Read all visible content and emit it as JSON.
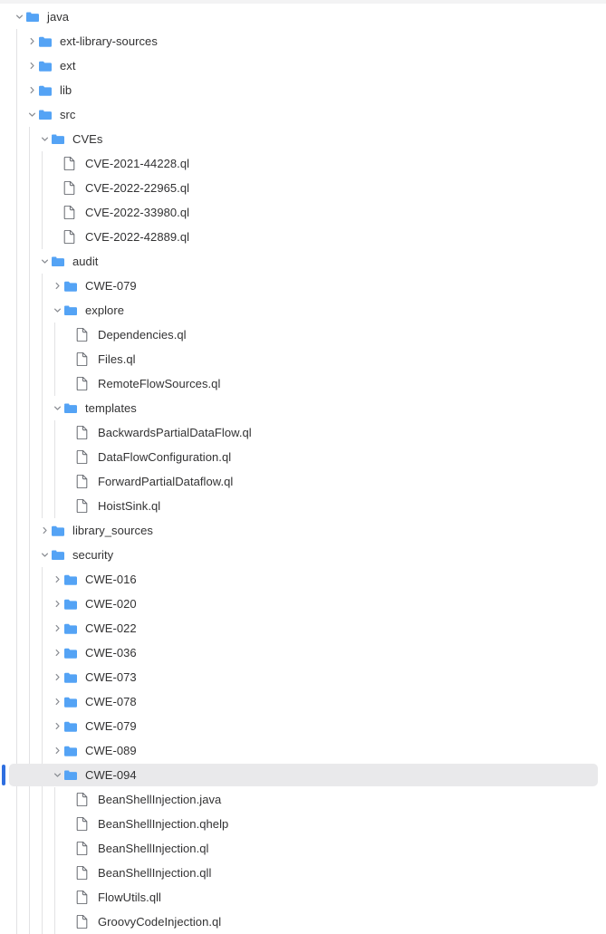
{
  "theme": {
    "background": "#ffffff",
    "text_color": "#323233",
    "folder_color": "#54a3f5",
    "file_icon_color": "#6b6e74",
    "chevron_color": "#8a8d93",
    "selection_background": "#e9e9eb",
    "selection_bar": "#2f6fe0",
    "guide_line": "#e2e2e4"
  },
  "tree": {
    "rows": [
      {
        "label": "java",
        "depth": 0,
        "type": "folder",
        "state": "expanded",
        "selected": false
      },
      {
        "label": "ext-library-sources",
        "depth": 1,
        "type": "folder",
        "state": "collapsed",
        "selected": false
      },
      {
        "label": "ext",
        "depth": 1,
        "type": "folder",
        "state": "collapsed",
        "selected": false
      },
      {
        "label": "lib",
        "depth": 1,
        "type": "folder",
        "state": "collapsed",
        "selected": false
      },
      {
        "label": "src",
        "depth": 1,
        "type": "folder",
        "state": "expanded",
        "selected": false
      },
      {
        "label": "CVEs",
        "depth": 2,
        "type": "folder",
        "state": "expanded",
        "selected": false
      },
      {
        "label": "CVE-2021-44228.ql",
        "depth": 3,
        "type": "file",
        "state": "none",
        "selected": false
      },
      {
        "label": "CVE-2022-22965.ql",
        "depth": 3,
        "type": "file",
        "state": "none",
        "selected": false
      },
      {
        "label": "CVE-2022-33980.ql",
        "depth": 3,
        "type": "file",
        "state": "none",
        "selected": false
      },
      {
        "label": "CVE-2022-42889.ql",
        "depth": 3,
        "type": "file",
        "state": "none",
        "selected": false
      },
      {
        "label": "audit",
        "depth": 2,
        "type": "folder",
        "state": "expanded",
        "selected": false
      },
      {
        "label": "CWE-079",
        "depth": 3,
        "type": "folder",
        "state": "collapsed",
        "selected": false
      },
      {
        "label": "explore",
        "depth": 3,
        "type": "folder",
        "state": "expanded",
        "selected": false
      },
      {
        "label": "Dependencies.ql",
        "depth": 4,
        "type": "file",
        "state": "none",
        "selected": false
      },
      {
        "label": "Files.ql",
        "depth": 4,
        "type": "file",
        "state": "none",
        "selected": false
      },
      {
        "label": "RemoteFlowSources.ql",
        "depth": 4,
        "type": "file",
        "state": "none",
        "selected": false
      },
      {
        "label": "templates",
        "depth": 3,
        "type": "folder",
        "state": "expanded",
        "selected": false
      },
      {
        "label": "BackwardsPartialDataFlow.ql",
        "depth": 4,
        "type": "file",
        "state": "none",
        "selected": false
      },
      {
        "label": "DataFlowConfiguration.ql",
        "depth": 4,
        "type": "file",
        "state": "none",
        "selected": false
      },
      {
        "label": "ForwardPartialDataflow.ql",
        "depth": 4,
        "type": "file",
        "state": "none",
        "selected": false
      },
      {
        "label": "HoistSink.ql",
        "depth": 4,
        "type": "file",
        "state": "none",
        "selected": false
      },
      {
        "label": "library_sources",
        "depth": 2,
        "type": "folder",
        "state": "collapsed",
        "selected": false
      },
      {
        "label": "security",
        "depth": 2,
        "type": "folder",
        "state": "expanded",
        "selected": false
      },
      {
        "label": "CWE-016",
        "depth": 3,
        "type": "folder",
        "state": "collapsed",
        "selected": false
      },
      {
        "label": "CWE-020",
        "depth": 3,
        "type": "folder",
        "state": "collapsed",
        "selected": false
      },
      {
        "label": "CWE-022",
        "depth": 3,
        "type": "folder",
        "state": "collapsed",
        "selected": false
      },
      {
        "label": "CWE-036",
        "depth": 3,
        "type": "folder",
        "state": "collapsed",
        "selected": false
      },
      {
        "label": "CWE-073",
        "depth": 3,
        "type": "folder",
        "state": "collapsed",
        "selected": false
      },
      {
        "label": "CWE-078",
        "depth": 3,
        "type": "folder",
        "state": "collapsed",
        "selected": false
      },
      {
        "label": "CWE-079",
        "depth": 3,
        "type": "folder",
        "state": "collapsed",
        "selected": false
      },
      {
        "label": "CWE-089",
        "depth": 3,
        "type": "folder",
        "state": "collapsed",
        "selected": false
      },
      {
        "label": "CWE-094",
        "depth": 3,
        "type": "folder",
        "state": "expanded",
        "selected": true
      },
      {
        "label": "BeanShellInjection.java",
        "depth": 4,
        "type": "file",
        "state": "none",
        "selected": false
      },
      {
        "label": "BeanShellInjection.qhelp",
        "depth": 4,
        "type": "file",
        "state": "none",
        "selected": false
      },
      {
        "label": "BeanShellInjection.ql",
        "depth": 4,
        "type": "file",
        "state": "none",
        "selected": false
      },
      {
        "label": "BeanShellInjection.qll",
        "depth": 4,
        "type": "file",
        "state": "none",
        "selected": false
      },
      {
        "label": "FlowUtils.qll",
        "depth": 4,
        "type": "file",
        "state": "none",
        "selected": false
      },
      {
        "label": "GroovyCodeInjection.ql",
        "depth": 4,
        "type": "file",
        "state": "none",
        "selected": false
      }
    ]
  },
  "icons": {
    "folder_open": "folder-open-icon",
    "folder_closed": "folder-closed-icon",
    "file": "file-icon",
    "chevron_down": "chevron-down-icon",
    "chevron_right": "chevron-right-icon"
  }
}
